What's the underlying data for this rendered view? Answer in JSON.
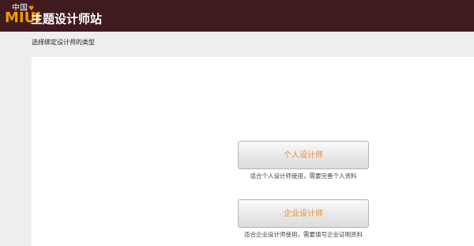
{
  "header": {
    "logo_small": "中国",
    "logo_brand": "MIUI",
    "site_name": "主题设计师站"
  },
  "page": {
    "subtitle": "选择绑定设计师的类型"
  },
  "options": [
    {
      "label": "个人设计师",
      "description": "适合个人设计师使用，需要完善个人资料"
    },
    {
      "label": "企业设计师",
      "description": "适合企业设计师使用，需要填写企业证明资料"
    }
  ],
  "colors": {
    "header_bg": "#3f1b1f",
    "brand_orange": "#f39a00",
    "button_text": "#f08a2c"
  }
}
